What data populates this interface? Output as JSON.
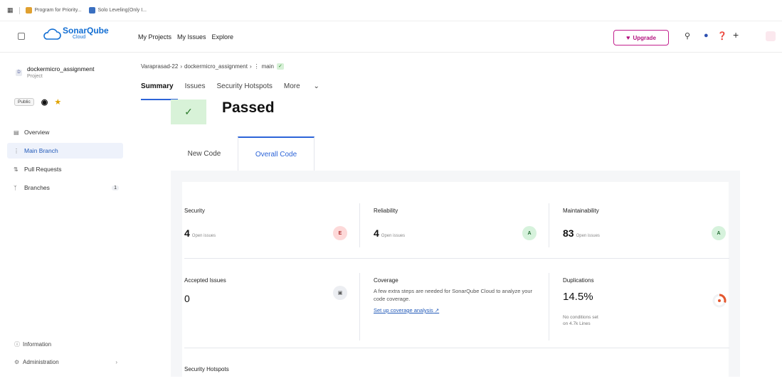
{
  "bookmarks": [
    {
      "label": "Program for Priority...",
      "color": "#e0a030"
    },
    {
      "label": "Solo Leveling(Only I...",
      "color": "#3a6fc0"
    }
  ],
  "header": {
    "brand": "SonarQube",
    "brand_sub": "Cloud",
    "nav": [
      "My Projects",
      "My Issues",
      "Explore"
    ],
    "upgrade_label": "Upgrade"
  },
  "sidebar": {
    "project_initial": "D",
    "project_name": "dockermicro_assignment",
    "project_type": "Project",
    "visibility": "Public",
    "items": [
      {
        "label": "Overview",
        "icon": "overview-icon"
      },
      {
        "label": "Main Branch",
        "icon": "branch-icon"
      },
      {
        "label": "Pull Requests",
        "icon": "pull-request-icon"
      },
      {
        "label": "Branches",
        "icon": "branches-icon",
        "count": "1"
      }
    ],
    "footer": [
      {
        "label": "Information",
        "icon": "info-icon"
      },
      {
        "label": "Administration",
        "icon": "gear-icon"
      }
    ]
  },
  "breadcrumb": {
    "org": "Varaprasad-22",
    "project": "dockermicro_assignment",
    "branch": "main"
  },
  "tabs": [
    "Summary",
    "Issues",
    "Security Hotspots",
    "More"
  ],
  "gate": {
    "status": "Passed"
  },
  "code_tabs": {
    "new": "New Code",
    "overall": "Overall Code"
  },
  "metrics": {
    "security": {
      "label": "Security",
      "value": "4",
      "suffix": "Open issues",
      "grade": "E"
    },
    "reliability": {
      "label": "Reliability",
      "value": "4",
      "suffix": "Open issues",
      "grade": "A"
    },
    "maintainability": {
      "label": "Maintainability",
      "value": "83",
      "suffix": "Open issues",
      "grade": "A"
    },
    "accepted": {
      "label": "Accepted Issues",
      "value": "0"
    },
    "coverage": {
      "label": "Coverage",
      "text": "A few extra steps are needed for SonarQube Cloud to analyze your code coverage.",
      "link": "Set up coverage analysis"
    },
    "duplications": {
      "label": "Duplications",
      "value": "14.5%",
      "note_1": "No conditions set",
      "note_2": "on 4.7k Lines"
    },
    "hotspots": {
      "label": "Security Hotspots"
    }
  },
  "colors": {
    "accent": "#2c64d8",
    "upgrade": "#c2208e",
    "passed_bg": "#d8f2d8"
  }
}
